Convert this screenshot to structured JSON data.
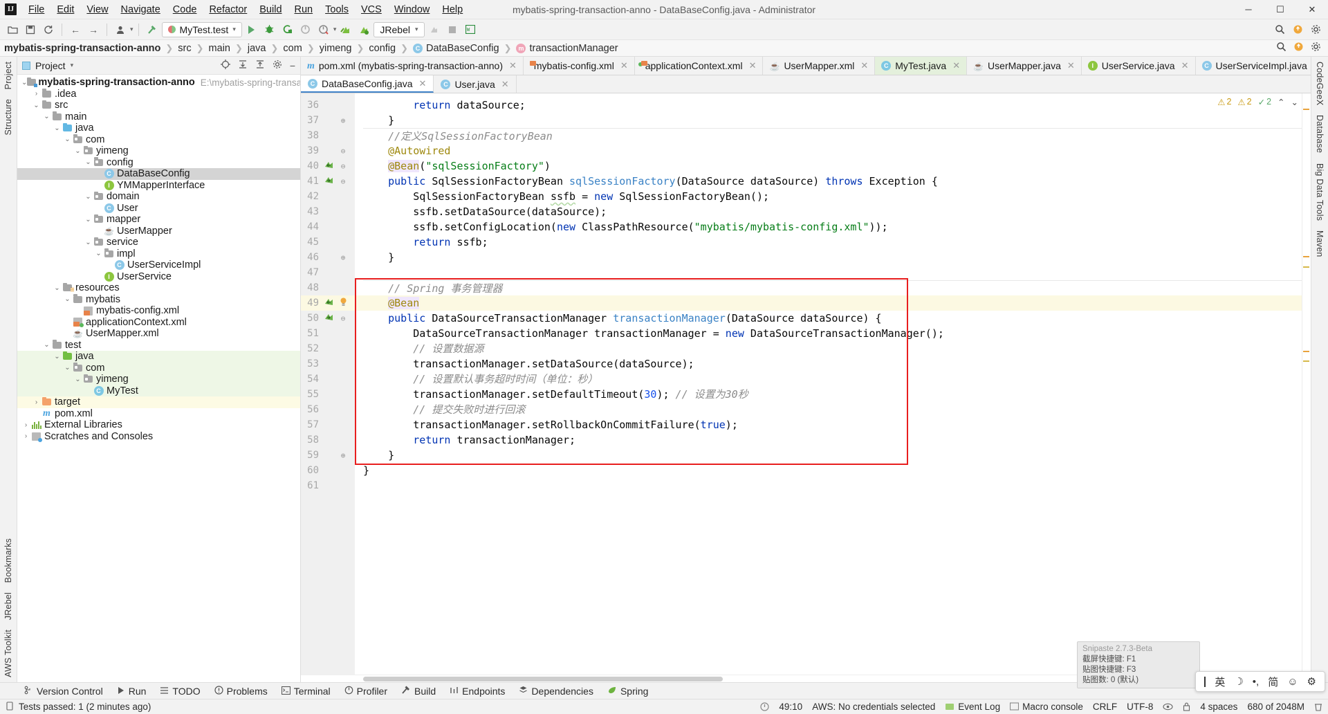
{
  "titlebar": {
    "logo": "IJ",
    "title": "mybatis-spring-transaction-anno - DataBaseConfig.java - Administrator",
    "menus": [
      "File",
      "Edit",
      "View",
      "Navigate",
      "Code",
      "Refactor",
      "Build",
      "Run",
      "Tools",
      "VCS",
      "Window",
      "Help"
    ],
    "window_controls": {
      "minimize": "─",
      "maximize": "☐",
      "close": "✕"
    }
  },
  "toolbar": {
    "open_icon": "folder-open-icon",
    "save_icon": "save-icon",
    "sync_icon": "sync-icon",
    "back_icon": "←",
    "forward_icon": "→",
    "profile_icon": "user-icon",
    "build_icon": "hammer-icon",
    "run_config": "MyTest.test",
    "run_icon": "run-icon",
    "debug_icon": "debug-icon",
    "coverage_icon": "coverage-icon",
    "profiler_icon": "profiler-icon",
    "rerun_icon": "rerun-icon",
    "jrebel_run_icon": "jrebel-run-icon",
    "jrebel_debug_icon": "jrebel-debug-icon",
    "jrebel_label": "JRebel",
    "stop_icon": "stop-icon",
    "search_icon": "search-icon",
    "updates_icon": "updates-icon",
    "settings_icon": "gear-icon",
    "translate_icon": "translate-icon"
  },
  "breadcrumb": {
    "items": [
      {
        "label": "mybatis-spring-transaction-anno",
        "bold": true,
        "icon": ""
      },
      {
        "label": "src",
        "bold": false,
        "icon": ""
      },
      {
        "label": "main",
        "bold": false,
        "icon": ""
      },
      {
        "label": "java",
        "bold": false,
        "icon": ""
      },
      {
        "label": "com",
        "bold": false,
        "icon": ""
      },
      {
        "label": "yimeng",
        "bold": false,
        "icon": ""
      },
      {
        "label": "config",
        "bold": false,
        "icon": ""
      },
      {
        "label": "DataBaseConfig",
        "bold": false,
        "icon": "class-badge"
      },
      {
        "label": "transactionManager",
        "bold": false,
        "icon": "method-badge"
      }
    ]
  },
  "project_panel": {
    "header": {
      "title": "Project",
      "caret": "▾"
    },
    "tools": {
      "locate": "crosshair-icon",
      "expand_all": "expand-all-icon",
      "collapse_all": "collapse-all-icon",
      "settings": "gear-icon",
      "hide": "minimize-icon"
    },
    "tree": [
      {
        "depth": 0,
        "arrow": "down",
        "icon": "folder-module",
        "label": "mybatis-spring-transaction-anno",
        "bold": true,
        "path": "E:\\mybatis-spring-transaction-anno",
        "state": ""
      },
      {
        "depth": 1,
        "arrow": "right",
        "icon": "folder",
        "label": ".idea",
        "state": ""
      },
      {
        "depth": 1,
        "arrow": "down",
        "icon": "folder",
        "label": "src",
        "state": ""
      },
      {
        "depth": 2,
        "arrow": "down",
        "icon": "folder",
        "label": "main",
        "state": ""
      },
      {
        "depth": 3,
        "arrow": "down",
        "icon": "folder-blue",
        "label": "java",
        "state": ""
      },
      {
        "depth": 4,
        "arrow": "down",
        "icon": "folder-pkg",
        "label": "com",
        "state": ""
      },
      {
        "depth": 5,
        "arrow": "down",
        "icon": "folder-pkg",
        "label": "yimeng",
        "state": ""
      },
      {
        "depth": 6,
        "arrow": "down",
        "icon": "folder-pkg",
        "label": "config",
        "state": ""
      },
      {
        "depth": 7,
        "arrow": "none",
        "icon": "class",
        "label": "DataBaseConfig",
        "state": "selected"
      },
      {
        "depth": 7,
        "arrow": "none",
        "icon": "interface",
        "label": "YMMapperInterface",
        "state": ""
      },
      {
        "depth": 6,
        "arrow": "down",
        "icon": "folder-pkg",
        "label": "domain",
        "state": ""
      },
      {
        "depth": 7,
        "arrow": "none",
        "icon": "class",
        "label": "User",
        "state": ""
      },
      {
        "depth": 6,
        "arrow": "down",
        "icon": "folder-pkg",
        "label": "mapper",
        "state": ""
      },
      {
        "depth": 7,
        "arrow": "none",
        "icon": "mybatis",
        "label": "UserMapper",
        "state": ""
      },
      {
        "depth": 6,
        "arrow": "down",
        "icon": "folder-pkg",
        "label": "service",
        "state": ""
      },
      {
        "depth": 7,
        "arrow": "down",
        "icon": "folder-pkg",
        "label": "impl",
        "state": ""
      },
      {
        "depth": 8,
        "arrow": "none",
        "icon": "class",
        "label": "UserServiceImpl",
        "state": ""
      },
      {
        "depth": 7,
        "arrow": "none",
        "icon": "interface",
        "label": "UserService",
        "state": ""
      },
      {
        "depth": 3,
        "arrow": "down",
        "icon": "folder-res",
        "label": "resources",
        "state": ""
      },
      {
        "depth": 4,
        "arrow": "down",
        "icon": "folder",
        "label": "mybatis",
        "state": ""
      },
      {
        "depth": 5,
        "arrow": "none",
        "icon": "xml",
        "label": "mybatis-config.xml",
        "state": ""
      },
      {
        "depth": 4,
        "arrow": "none",
        "icon": "xml-ok",
        "label": "applicationContext.xml",
        "state": ""
      },
      {
        "depth": 4,
        "arrow": "none",
        "icon": "mybatis",
        "label": "UserMapper.xml",
        "state": ""
      },
      {
        "depth": 2,
        "arrow": "down",
        "icon": "folder",
        "label": "test",
        "state": ""
      },
      {
        "depth": 3,
        "arrow": "down",
        "icon": "folder-green",
        "label": "java",
        "state": "green"
      },
      {
        "depth": 4,
        "arrow": "down",
        "icon": "folder-pkg",
        "label": "com",
        "state": "green"
      },
      {
        "depth": 5,
        "arrow": "down",
        "icon": "folder-pkg",
        "label": "yimeng",
        "state": "green"
      },
      {
        "depth": 6,
        "arrow": "none",
        "icon": "test-class",
        "label": "MyTest",
        "state": "green"
      },
      {
        "depth": 1,
        "arrow": "right",
        "icon": "folder-orange",
        "label": "target",
        "state": "yellow"
      },
      {
        "depth": 1,
        "arrow": "none",
        "icon": "maven",
        "label": "pom.xml",
        "state": ""
      },
      {
        "depth": 0,
        "arrow": "right",
        "icon": "libraries",
        "label": "External Libraries",
        "state": ""
      },
      {
        "depth": 0,
        "arrow": "right",
        "icon": "scratches",
        "label": "Scratches and Consoles",
        "state": ""
      }
    ]
  },
  "left_rail": {
    "top": "Project",
    "bottom": [
      "AWS Toolkit",
      "JRebel",
      "Bookmarks",
      "Structure"
    ]
  },
  "right_rail": {
    "items": [
      "CodeGeeX",
      "Database",
      "Big Data Tools",
      "Maven"
    ]
  },
  "editor": {
    "file_tabs": [
      {
        "label": "pom.xml (mybatis-spring-transaction-anno)",
        "icon": "maven-icon",
        "active": false
      },
      {
        "label": "mybatis-config.xml",
        "icon": "xml-icon",
        "active": false
      },
      {
        "label": "applicationContext.xml",
        "icon": "xml-spring-icon",
        "active": false
      },
      {
        "label": "UserMapper.xml",
        "icon": "mybatis-icon",
        "active": false
      },
      {
        "label": "MyTest.java",
        "icon": "test-class-icon",
        "active": true
      },
      {
        "label": "UserMapper.java",
        "icon": "mybatis-icon",
        "active": false
      },
      {
        "label": "UserService.java",
        "icon": "interface-icon",
        "active": false
      },
      {
        "label": "UserServiceImpl.java",
        "icon": "class-icon",
        "active": false
      }
    ],
    "more_tabs_icon": "⋮",
    "sub_tabs": [
      {
        "label": "DataBaseConfig.java",
        "icon": "class-icon",
        "active": true
      },
      {
        "label": "User.java",
        "icon": "class-icon",
        "active": false
      }
    ],
    "analysis": {
      "warnings": "2",
      "weak_warnings": "2",
      "errors": "2",
      "up": "⌃",
      "down": "⌄"
    },
    "lines": [
      {
        "n": 36,
        "indent": 2,
        "run": "",
        "fold": "",
        "hl": false,
        "sep": false,
        "tokens": [
          {
            "t": "kw",
            "v": "return"
          },
          {
            "t": "",
            "v": " dataSource;"
          }
        ]
      },
      {
        "n": 37,
        "indent": 1,
        "run": "",
        "fold": "end",
        "hl": false,
        "sep": false,
        "tokens": [
          {
            "t": "",
            "v": "}"
          }
        ]
      },
      {
        "n": 38,
        "indent": 1,
        "run": "",
        "fold": "",
        "hl": false,
        "sep": true,
        "tokens": [
          {
            "t": "cmt",
            "v": "//定义SqlSessionFactoryBean"
          }
        ]
      },
      {
        "n": 39,
        "indent": 1,
        "run": "",
        "fold": "start",
        "hl": false,
        "sep": false,
        "tokens": [
          {
            "t": "ann",
            "v": "@Autowired"
          }
        ]
      },
      {
        "n": 40,
        "indent": 1,
        "run": "impl",
        "fold": "start",
        "hl": false,
        "sep": false,
        "tokens": [
          {
            "t": "ann-hl",
            "v": "@Bean"
          },
          {
            "t": "",
            "v": "("
          },
          {
            "t": "str",
            "v": "\"sqlSessionFactory\""
          },
          {
            "t": "",
            "v": ")"
          }
        ]
      },
      {
        "n": 41,
        "indent": 1,
        "run": "over",
        "fold": "start",
        "hl": false,
        "sep": false,
        "tokens": [
          {
            "t": "kw",
            "v": "public"
          },
          {
            "t": "",
            "v": " SqlSessionFactoryBean "
          },
          {
            "t": "mname",
            "v": "sqlSessionFactory"
          },
          {
            "t": "",
            "v": "(DataSource dataSource) "
          },
          {
            "t": "kw",
            "v": "throws"
          },
          {
            "t": "",
            "v": " "
          },
          {
            "t": "excp",
            "v": "Exception"
          },
          {
            "t": "",
            "v": " {"
          }
        ]
      },
      {
        "n": 42,
        "indent": 2,
        "run": "",
        "fold": "",
        "hl": false,
        "sep": false,
        "tokens": [
          {
            "t": "",
            "v": "SqlSessionFactoryBean "
          },
          {
            "t": "squig",
            "v": "ssfb"
          },
          {
            "t": "",
            "v": " = "
          },
          {
            "t": "kw",
            "v": "new"
          },
          {
            "t": "",
            "v": " SqlSessionFactoryBean();"
          }
        ]
      },
      {
        "n": 43,
        "indent": 2,
        "run": "",
        "fold": "",
        "hl": false,
        "sep": false,
        "tokens": [
          {
            "t": "",
            "v": "ssfb.setDataSource(dataSource);"
          }
        ]
      },
      {
        "n": 44,
        "indent": 2,
        "run": "",
        "fold": "",
        "hl": false,
        "sep": false,
        "tokens": [
          {
            "t": "",
            "v": "ssfb.setConfigLocation("
          },
          {
            "t": "kw",
            "v": "new"
          },
          {
            "t": "",
            "v": " ClassPathResource("
          },
          {
            "t": "str",
            "v": "\"mybatis/mybatis-config.xml\""
          },
          {
            "t": "",
            "v": "));"
          }
        ]
      },
      {
        "n": 45,
        "indent": 2,
        "run": "",
        "fold": "",
        "hl": false,
        "sep": false,
        "tokens": [
          {
            "t": "kw",
            "v": "return"
          },
          {
            "t": "",
            "v": " ssfb;"
          }
        ]
      },
      {
        "n": 46,
        "indent": 1,
        "run": "",
        "fold": "end",
        "hl": false,
        "sep": false,
        "tokens": [
          {
            "t": "",
            "v": "}"
          }
        ]
      },
      {
        "n": 47,
        "indent": 0,
        "run": "",
        "fold": "",
        "hl": false,
        "sep": false,
        "tokens": []
      },
      {
        "n": 48,
        "indent": 1,
        "run": "",
        "fold": "",
        "hl": false,
        "sep": true,
        "tokens": [
          {
            "t": "cmt",
            "v": "// Spring 事务管理器"
          }
        ]
      },
      {
        "n": 49,
        "indent": 1,
        "run": "impl",
        "fold": "bulb",
        "hl": true,
        "sep": false,
        "tokens": [
          {
            "t": "ann-hl",
            "v": "@Bean"
          }
        ]
      },
      {
        "n": 50,
        "indent": 1,
        "run": "over",
        "fold": "start",
        "hl": false,
        "sep": false,
        "tokens": [
          {
            "t": "kw",
            "v": "public"
          },
          {
            "t": "",
            "v": " DataSourceTransactionManager "
          },
          {
            "t": "mname",
            "v": "transactionManager"
          },
          {
            "t": "",
            "v": "(DataSource dataSource) {"
          }
        ]
      },
      {
        "n": 51,
        "indent": 2,
        "run": "",
        "fold": "",
        "hl": false,
        "sep": false,
        "tokens": [
          {
            "t": "",
            "v": "DataSourceTransactionManager transactionManager = "
          },
          {
            "t": "kw",
            "v": "new"
          },
          {
            "t": "",
            "v": " DataSourceTransactionManager();"
          }
        ]
      },
      {
        "n": 52,
        "indent": 2,
        "run": "",
        "fold": "",
        "hl": false,
        "sep": false,
        "tokens": [
          {
            "t": "cmt",
            "v": "// 设置数据源"
          }
        ]
      },
      {
        "n": 53,
        "indent": 2,
        "run": "",
        "fold": "",
        "hl": false,
        "sep": false,
        "tokens": [
          {
            "t": "",
            "v": "transactionManager.setDataSource(dataSource);"
          }
        ]
      },
      {
        "n": 54,
        "indent": 2,
        "run": "",
        "fold": "",
        "hl": false,
        "sep": false,
        "tokens": [
          {
            "t": "cmt",
            "v": "// 设置默认事务超时时间（单位：秒）"
          }
        ]
      },
      {
        "n": 55,
        "indent": 2,
        "run": "",
        "fold": "",
        "hl": false,
        "sep": false,
        "tokens": [
          {
            "t": "",
            "v": "transactionManager.setDefaultTimeout("
          },
          {
            "t": "num",
            "v": "30"
          },
          {
            "t": "",
            "v": "); "
          },
          {
            "t": "cmt",
            "v": "// 设置为30秒"
          }
        ]
      },
      {
        "n": 56,
        "indent": 2,
        "run": "",
        "fold": "",
        "hl": false,
        "sep": false,
        "tokens": [
          {
            "t": "cmt",
            "v": "// 提交失败时进行回滚"
          }
        ]
      },
      {
        "n": 57,
        "indent": 2,
        "run": "",
        "fold": "",
        "hl": false,
        "sep": false,
        "tokens": [
          {
            "t": "",
            "v": "transactionManager.setRollbackOnCommitFailure("
          },
          {
            "t": "kw",
            "v": "true"
          },
          {
            "t": "",
            "v": ");"
          }
        ]
      },
      {
        "n": 58,
        "indent": 2,
        "run": "",
        "fold": "",
        "hl": false,
        "sep": false,
        "tokens": [
          {
            "t": "kw",
            "v": "return"
          },
          {
            "t": "",
            "v": " transactionManager;"
          }
        ]
      },
      {
        "n": 59,
        "indent": 1,
        "run": "",
        "fold": "end",
        "hl": false,
        "sep": false,
        "tokens": [
          {
            "t": "",
            "v": "}"
          }
        ]
      },
      {
        "n": 60,
        "indent": 0,
        "run": "",
        "fold": "",
        "hl": false,
        "sep": false,
        "tokens": [
          {
            "t": "",
            "v": "}"
          }
        ]
      },
      {
        "n": 61,
        "indent": 0,
        "run": "",
        "fold": "",
        "hl": false,
        "sep": false,
        "tokens": []
      }
    ]
  },
  "bottom_bar": [
    {
      "label": "Version Control",
      "icon": "branch-icon"
    },
    {
      "label": "Run",
      "icon": "run-icon"
    },
    {
      "label": "TODO",
      "icon": "todo-icon"
    },
    {
      "label": "Problems",
      "icon": "problems-icon"
    },
    {
      "label": "Terminal",
      "icon": "terminal-icon"
    },
    {
      "label": "Profiler",
      "icon": "profiler-icon"
    },
    {
      "label": "Build",
      "icon": "hammer-icon"
    },
    {
      "label": "Endpoints",
      "icon": "endpoints-icon"
    },
    {
      "label": "Dependencies",
      "icon": "dependencies-icon"
    },
    {
      "label": "Spring",
      "icon": "spring-leaf-icon"
    }
  ],
  "statusbar": {
    "left_icon": "test-tube-icon",
    "left_text": "Tests passed: 1 (2 minutes ago)",
    "caret": "49:10",
    "aws": "AWS: No credentials selected",
    "line_sep": "CRLF",
    "encoding": "UTF-8",
    "indent": "4 spaces",
    "memory": "680 of 2048M",
    "event_log": "Event Log",
    "macro_console": "Macro console",
    "lock_icon": "lock-icon",
    "eye_icon": "eye-icon",
    "bin_icon": "trash-icon"
  },
  "ime": {
    "cursor": "|",
    "lang": "英",
    "moon": "☽",
    "punct": "•,",
    "mode": "简",
    "emoji": "☺",
    "gear": "⚙"
  },
  "snipaste": {
    "title": "Snipaste 2.7.3-Beta",
    "lines": [
      "截屏快捷键: F1",
      "贴图快捷键: F3",
      "贴图数: 0 (默认)"
    ]
  },
  "colors": {
    "accent_blue": "#4083c9",
    "active_tab_green": "#e4f0dc",
    "redbox": "#e81e1e",
    "keyword": "#0033b3",
    "string": "#067d17",
    "comment": "#8c8c8c",
    "annotation": "#9e880d",
    "number": "#1750eb",
    "method": "#3a82c5",
    "highlight_line": "#fcf9e2"
  }
}
